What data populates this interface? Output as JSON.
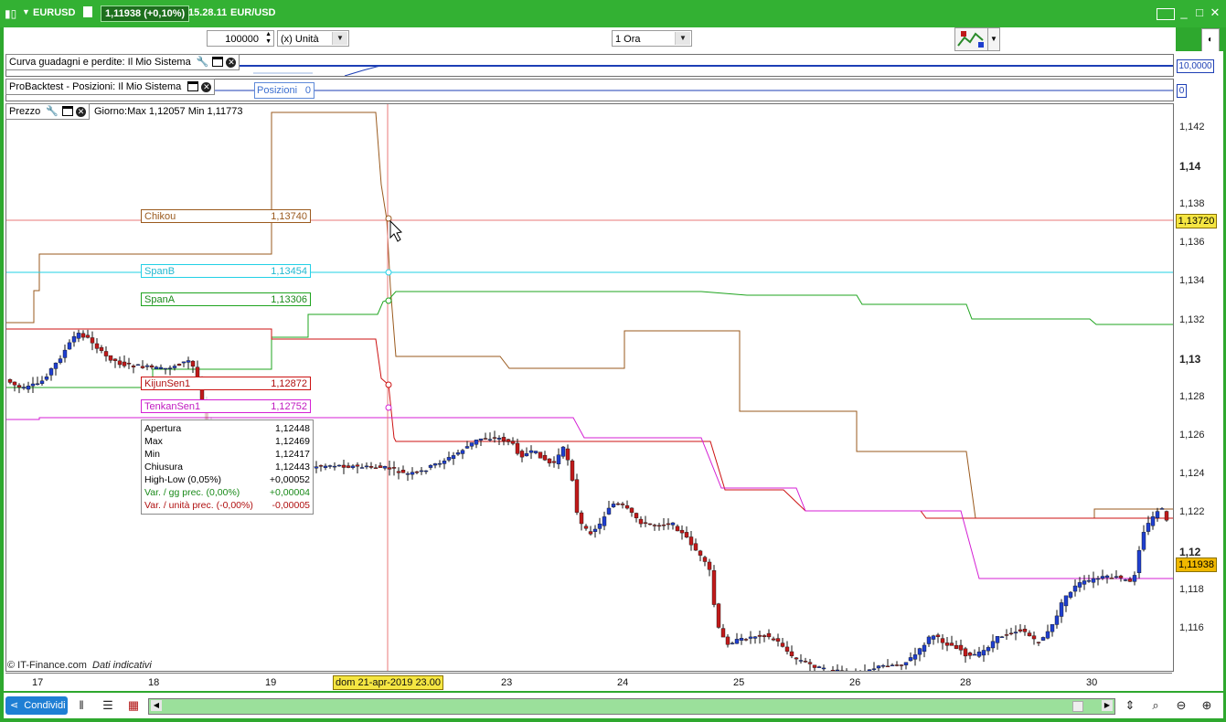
{
  "window": {
    "symbol": "EURUSD",
    "price_change": "1,11938 (+0,10%)",
    "time": "15.28.11",
    "instrument": "EUR/USD",
    "minimize": "_",
    "maximize": "□",
    "close": "✕"
  },
  "toolbar": {
    "quantity": "100000",
    "unit_select": "(x) Unità",
    "timeframe_select": "1 Ora"
  },
  "panels": {
    "equity_curve": {
      "title": "Curva guadagni e perdite: Il Mio Sistema",
      "axis_value": "10,0000"
    },
    "positions": {
      "title": "ProBacktest - Posizioni: Il Mio Sistema",
      "tag_label": "Posizioni",
      "tag_value": "0",
      "axis_value": "0"
    },
    "price": {
      "title": "Prezzo",
      "day_range": "Giorno:Max 1,12057 Min 1,11773"
    }
  },
  "indicators": [
    {
      "name": "Chikou",
      "value": "1,13740",
      "color": "#9a5a1e"
    },
    {
      "name": "SpanB",
      "value": "1,13454",
      "color": "#22d0e6"
    },
    {
      "name": "SpanA",
      "value": "1,13306",
      "color": "#1fa41f"
    },
    {
      "name": "KijunSen1",
      "value": "1,12872",
      "color": "#cc1111"
    },
    {
      "name": "TenkanSen1",
      "value": "1,12752",
      "color": "#d41fd4"
    }
  ],
  "info_box": [
    {
      "label": "Apertura",
      "value": "1,12448",
      "color": "#000000"
    },
    {
      "label": "Max",
      "value": "1,12469",
      "color": "#000000"
    },
    {
      "label": "Min",
      "value": "1,12417",
      "color": "#000000"
    },
    {
      "label": "Chiusura",
      "value": "1,12443",
      "color": "#000000"
    },
    {
      "label": "High-Low (0,05%)",
      "value": "+0,00052",
      "color": "#000000"
    },
    {
      "label": "Var. / gg prec. (0,00%)",
      "value": "+0,00004",
      "color": "#1a8a1a"
    },
    {
      "label": "Var. / unità prec. (-0,00%)",
      "value": "-0,00005",
      "color": "#b01010"
    }
  ],
  "price_axis": {
    "ticks": [
      "1,142",
      "1,14",
      "1,138",
      "1,136",
      "1,134",
      "1,132",
      "1,13",
      "1,128",
      "1,126",
      "1,124",
      "1,122",
      "1,12",
      "1,118",
      "1,116"
    ],
    "crosshair_tag": "1,13720",
    "last_price_tag": "1,11938"
  },
  "date_axis": {
    "labels": [
      "17",
      "18",
      "19",
      "23",
      "24",
      "25",
      "26",
      "28",
      "30"
    ],
    "crosshair_date": "dom 21-apr-2019 23.00"
  },
  "watermark": {
    "source": "© IT-Finance.com",
    "note": "Dati indicativi"
  },
  "bottom": {
    "share_label": "Condividi"
  },
  "colors": {
    "up_candle": "#1f3fcf",
    "down_candle": "#c01a1a",
    "frame": "#2ea82e",
    "crosshair": "#e87a7a"
  },
  "chart_data": {
    "type": "candlestick",
    "symbol": "EURUSD",
    "timeframe": "1 Ora",
    "ylim": [
      1.1142,
      1.1432
    ],
    "ichimoku_current": {
      "Chikou": 1.1374,
      "SpanB": 1.13454,
      "SpanA": 1.13306,
      "KijunSen1": 1.12872,
      "TenkanSen1": 1.12752
    },
    "last_price": 1.11938
  }
}
